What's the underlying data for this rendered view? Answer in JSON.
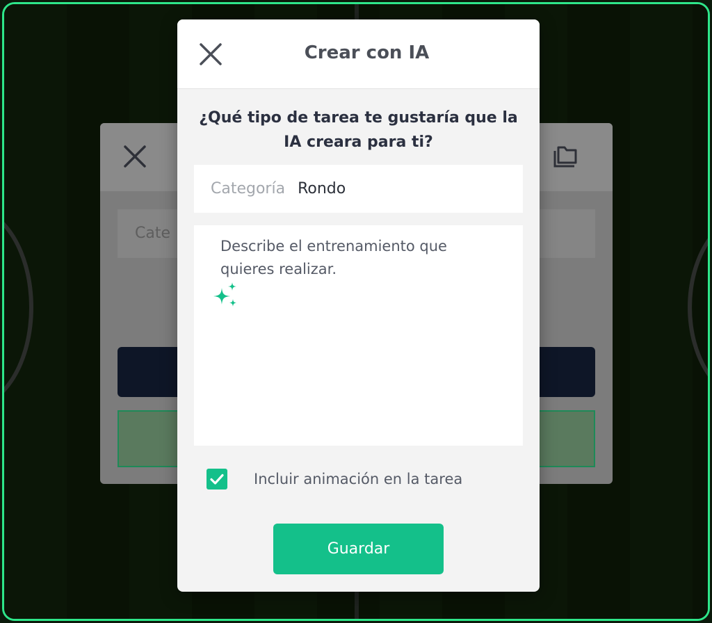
{
  "background_dialog": {
    "category_partial": "Cate"
  },
  "modal": {
    "title": "Crear con IA",
    "question": "¿Qué tipo de tarea te gustaría que la IA creara para ti?",
    "category": {
      "label": "Categoría",
      "value": "Rondo"
    },
    "description": {
      "placeholder": "Describe el entrenamiento que quieres realizar.",
      "icon": "sparkle-icon"
    },
    "animation_checkbox": {
      "label": "Incluir animación en la tarea",
      "checked": true
    },
    "save_label": "Guardar"
  },
  "colors": {
    "accent": "#14c08a",
    "frame_border": "#2ee68a",
    "title_text": "#4b4f58",
    "dark_button": "#0e1627"
  }
}
